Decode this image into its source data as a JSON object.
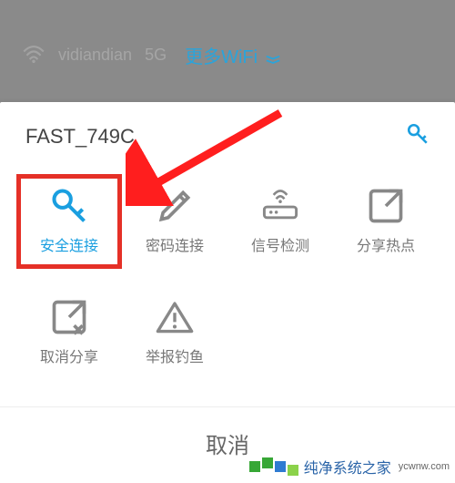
{
  "backdrop": {
    "dim_ssid": "vidiandian",
    "band": "5G",
    "more_wifi": "更多WiFi"
  },
  "sheet": {
    "ssid": "FAST_749C",
    "actions": [
      {
        "id": "secure-connect",
        "label": "安全连接",
        "selected": true
      },
      {
        "id": "pwd-connect",
        "label": "密码连接",
        "selected": false
      },
      {
        "id": "signal-test",
        "label": "信号检测",
        "selected": false
      },
      {
        "id": "share-hotspot",
        "label": "分享热点",
        "selected": false
      },
      {
        "id": "cancel-share",
        "label": "取消分享",
        "selected": false
      },
      {
        "id": "report-phish",
        "label": "举报钓鱼",
        "selected": false
      }
    ],
    "cancel": "取消"
  },
  "watermark": {
    "text": "纯净系统之家",
    "url": "ycwnw.com"
  },
  "colors": {
    "accent": "#1a9fe0",
    "highlight_box": "#e53027",
    "arrow": "#ff1e1e"
  }
}
